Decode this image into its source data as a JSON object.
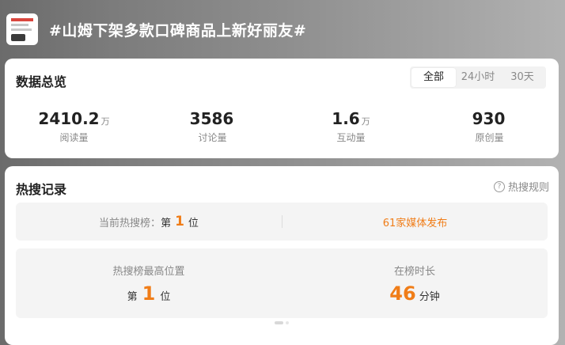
{
  "topic": {
    "title": "#山姆下架多款口碑商品上新好丽友#"
  },
  "overview": {
    "title": "数据总览",
    "tabs": [
      {
        "label": "全部",
        "active": true
      },
      {
        "label": "24小时",
        "active": false
      },
      {
        "label": "30天",
        "active": false
      }
    ],
    "stats": [
      {
        "value": "2410.2",
        "unit": "万",
        "label": "阅读量"
      },
      {
        "value": "3586",
        "unit": "",
        "label": "讨论量"
      },
      {
        "value": "1.6",
        "unit": "万",
        "label": "互动量"
      },
      {
        "value": "930",
        "unit": "",
        "label": "原创量"
      }
    ]
  },
  "hot": {
    "title": "热搜记录",
    "rule_link": "热搜规则",
    "help_glyph": "?",
    "current": {
      "label": "当前热搜榜：",
      "prefix": "第",
      "rank": "1",
      "suffix": "位"
    },
    "media": "61家媒体发布",
    "highest": {
      "label": "热搜榜最高位置",
      "prefix": "第",
      "rank": "1",
      "suffix": "位"
    },
    "duration": {
      "label": "在榜时长",
      "value": "46",
      "unit": "分钟"
    }
  },
  "colors": {
    "accent": "#f07d18",
    "card_bg": "#ffffff",
    "panel_bg": "#f4f4f4",
    "muted_text": "#888888"
  },
  "icons": {
    "topic_thumbnail": "topic-thumbnail-image",
    "help": "question-circle-icon"
  }
}
